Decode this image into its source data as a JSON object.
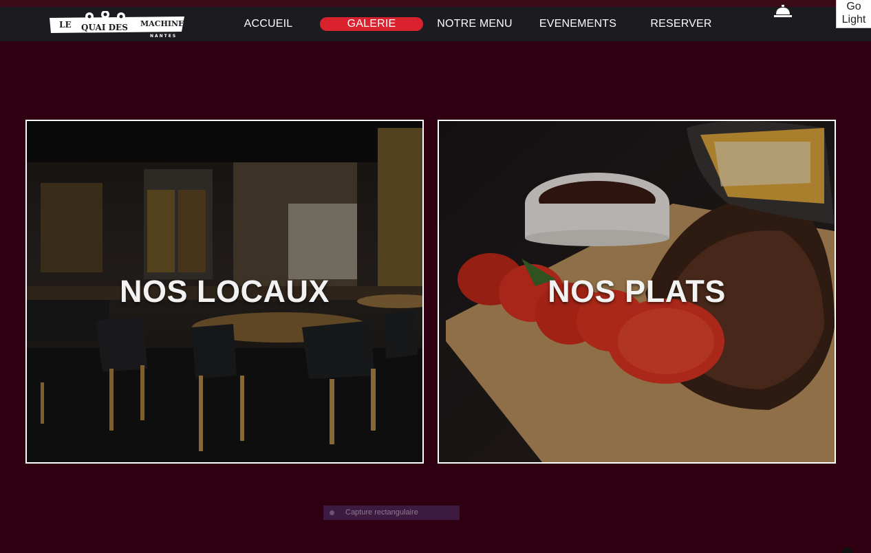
{
  "logo": {
    "line1": "LE",
    "line2": "QUAI DES",
    "line3": "MACHINES",
    "line4": "NANTES"
  },
  "nav": {
    "items": [
      {
        "label": "ACCUEIL",
        "active": false
      },
      {
        "label": "GALERIE",
        "active": true
      },
      {
        "label": "NOTRE MENU",
        "active": false
      },
      {
        "label": "EVENEMENTS",
        "active": false
      },
      {
        "label": "RESERVER",
        "active": false
      }
    ],
    "accent": "#d9222e",
    "bar_color": "#1b1b20"
  },
  "theme_toggle": {
    "label": "Go Light"
  },
  "bell_icon": "service-bell-icon",
  "gallery": {
    "cards": [
      {
        "title": "NOS LOCAUX",
        "image": "restaurant-interior-image"
      },
      {
        "title": "NOS PLATS",
        "image": "ribs-platter-image"
      }
    ]
  },
  "capture_widget": {
    "label": "Capture rectangulaire"
  },
  "colors": {
    "page_background": "#2e0012",
    "card_border": "#ffffff"
  }
}
